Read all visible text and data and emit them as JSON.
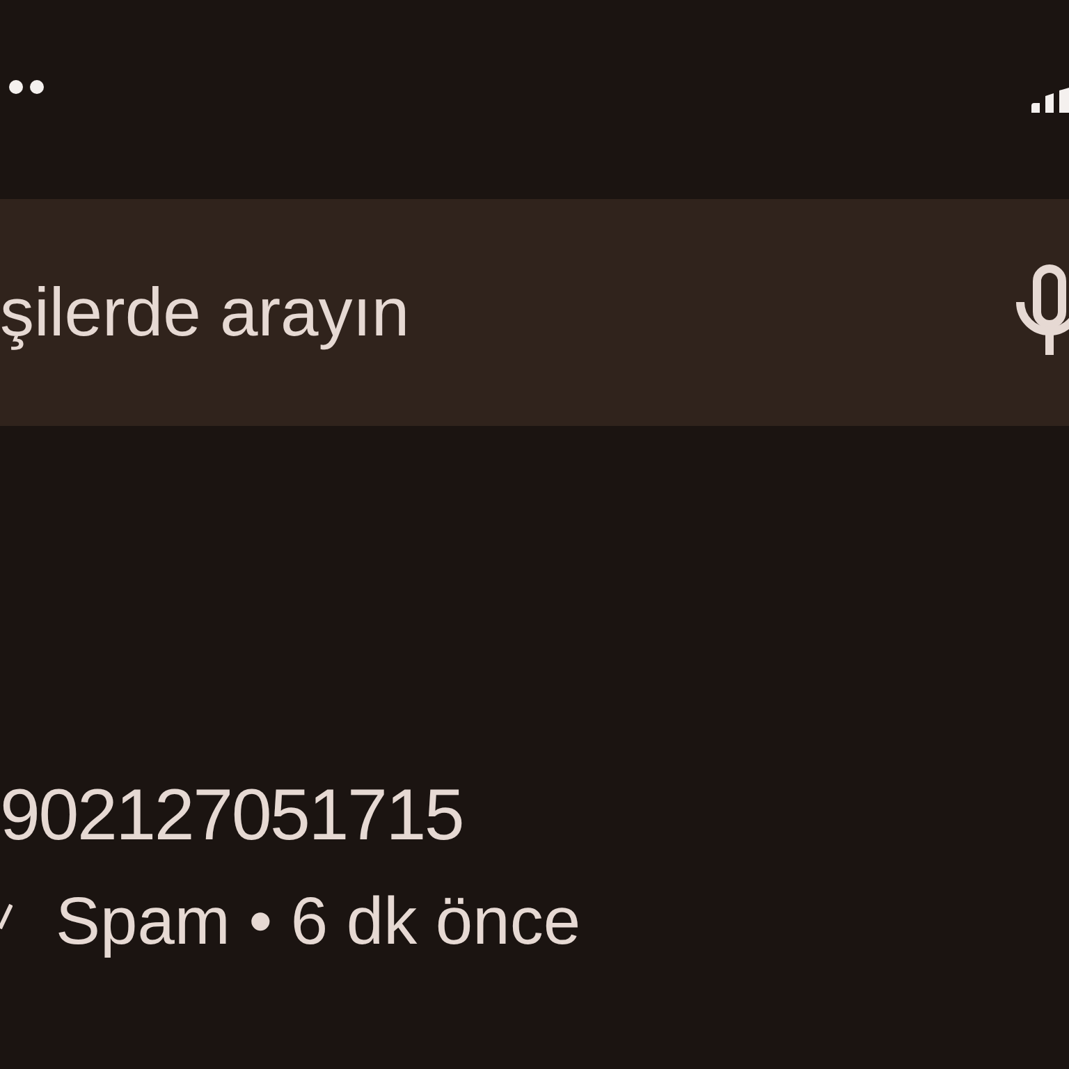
{
  "search": {
    "placeholder": "şilerde arayın"
  },
  "calls": [
    {
      "number": "902127051715",
      "details": "Spam • 6 dk önce"
    }
  ]
}
